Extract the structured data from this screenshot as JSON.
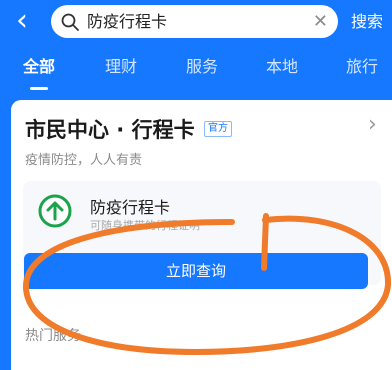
{
  "header": {
    "back_icon": "chevron-left-icon",
    "search_value": "防疫行程卡",
    "clear_icon": "clear-icon",
    "search_button": "搜索"
  },
  "tabs": [
    {
      "label": "全部",
      "active": true
    },
    {
      "label": "理财",
      "active": false
    },
    {
      "label": "服务",
      "active": false
    },
    {
      "label": "本地",
      "active": false
    },
    {
      "label": "旅行",
      "active": false
    }
  ],
  "card": {
    "title": "市民中心 · 行程卡",
    "official_badge": "官方",
    "subtitle": "疫情防控，人人有责",
    "service": {
      "name": "防疫行程卡",
      "description": "可随身携带的行程证明",
      "icon": "up-arrow-circle-icon"
    },
    "query_button": "立即查询"
  },
  "section": {
    "hot_services": "热门服务"
  },
  "colors": {
    "brand": "#1677ff",
    "icon_green": "#1aa34a",
    "annotation": "#f07b2a"
  }
}
